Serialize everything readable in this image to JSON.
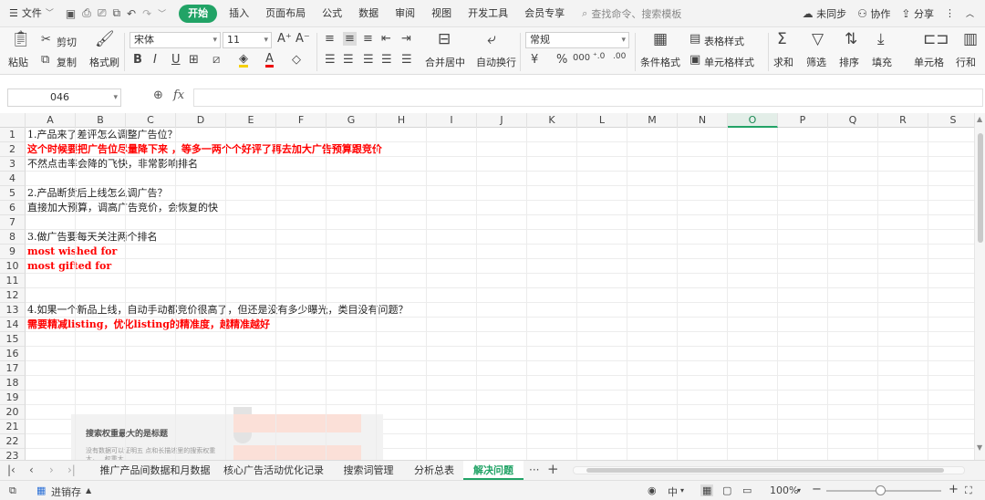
{
  "menubar": {
    "file_label": "文件",
    "tabs": [
      "开始",
      "插入",
      "页面布局",
      "公式",
      "数据",
      "审阅",
      "视图",
      "开发工具",
      "会员专享"
    ],
    "active_tab": "开始",
    "search_placeholder": "查找命令、搜索模板",
    "sync_label": "未同步",
    "collab_label": "协作",
    "share_label": "分享"
  },
  "ribbon": {
    "paste": "粘贴",
    "cut": "剪切",
    "copy": "复制",
    "format_painter": "格式刷",
    "font_name": "宋体",
    "font_size": "11",
    "merge_center": "合并居中",
    "wrap_text": "自动换行",
    "number_format": "常规",
    "conditional_format": "条件格式",
    "table_style": "表格样式",
    "cell_style": "单元格样式",
    "sum": "求和",
    "filter": "筛选",
    "sort": "排序",
    "fill": "填充",
    "cells": "单元格",
    "rows_cols": "行和"
  },
  "formula_bar": {
    "name_box": "046",
    "fx": "fx",
    "formula_value": ""
  },
  "grid": {
    "columns": [
      "A",
      "B",
      "C",
      "D",
      "E",
      "F",
      "G",
      "H",
      "I",
      "J",
      "K",
      "L",
      "M",
      "N",
      "O",
      "P",
      "Q",
      "R",
      "S"
    ],
    "selected_column": "O",
    "row_numbers": [
      "1",
      "2",
      "3",
      "4",
      "5",
      "6",
      "7",
      "8",
      "9",
      "10",
      "11",
      "12",
      "13",
      "14",
      "15",
      "16",
      "17",
      "18",
      "19",
      "20",
      "21",
      "22",
      "23"
    ],
    "cells": [
      {
        "row": "1",
        "text": "1.产品来了差评怎么调整广告位？",
        "color": "black"
      },
      {
        "row": "2",
        "text": "这个时候要把广告位尽量降下来 ，等多一两个个好评了再去加大广告预算跟竞价",
        "color": "red"
      },
      {
        "row": "3",
        "text": "不然点击率会降的飞快，非常影响排名",
        "color": "black"
      },
      {
        "row": "5",
        "text": "2.产品断货后上线怎么调广告？",
        "color": "black"
      },
      {
        "row": "6",
        "text": "直接加大预算，调高广告竞价，会恢复的快",
        "color": "black"
      },
      {
        "row": "8",
        "text": "3.做广告要每天关注两个排名",
        "color": "black"
      },
      {
        "row": "9",
        "text": "most wished for",
        "color": "red"
      },
      {
        "row": "10",
        "text": "most gifted for",
        "color": "red"
      },
      {
        "row": "13",
        "text": "4.如果一个新品上线，自动手动都竞价很高了，但还是没有多少曝光，类目没有问题？",
        "color": "black"
      },
      {
        "row": "14",
        "text": "需要精减listing，优化listing的精准度，越精准越好",
        "color": "red"
      }
    ],
    "picture": {
      "title": "搜索权重最大的是标题",
      "body": "没有数据可以证明五 点和长描述里的搜索权重大，...权重大..."
    }
  },
  "sheets": {
    "tabs": [
      "推广产品间数据和月数据",
      "核心广告活动优化记录",
      "搜索词管理",
      "分析总表",
      "解决问题"
    ],
    "active": "解决问题",
    "more": "···",
    "add": "+"
  },
  "statusbar": {
    "backup_label": "进销存",
    "input_mode": "中",
    "zoom": "100%"
  },
  "colors": {
    "accent": "#21a366",
    "red_text": "#ff0000"
  }
}
